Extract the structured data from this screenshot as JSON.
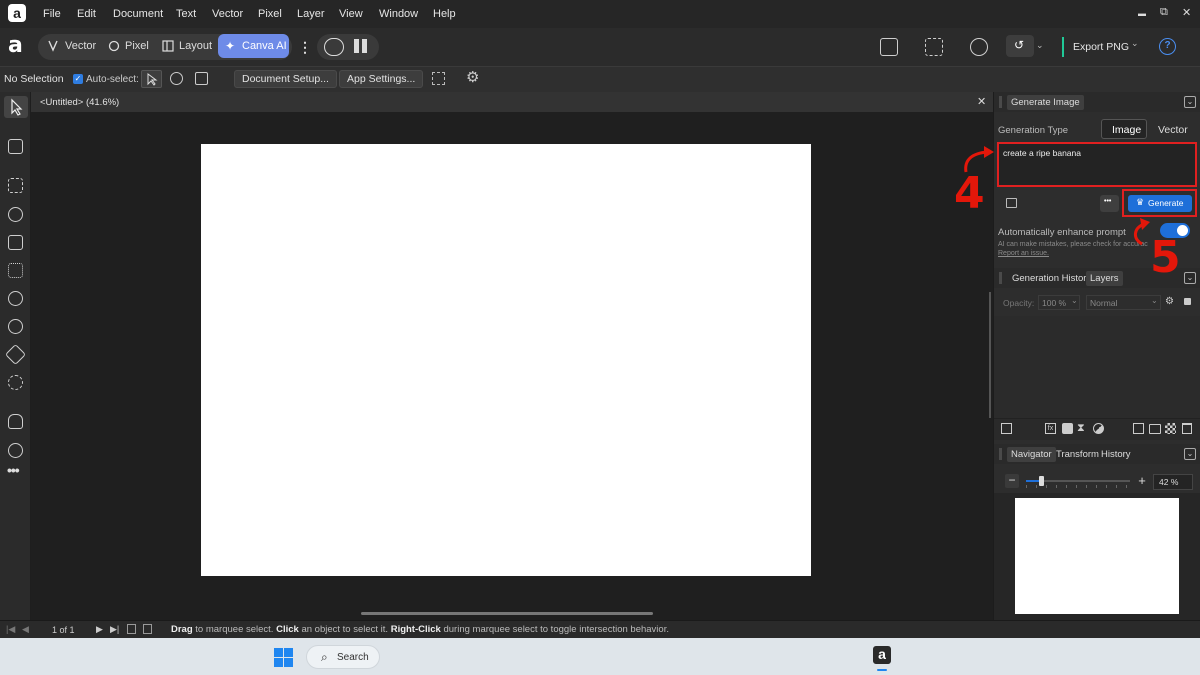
{
  "menu": [
    "File",
    "Edit",
    "Document",
    "Text",
    "Vector",
    "Pixel",
    "Layer",
    "View",
    "Window",
    "Help"
  ],
  "window_controls": {
    "minimize": "▬",
    "restore": "⧉",
    "close": "✕"
  },
  "personas": {
    "vector": "Vector",
    "pixel": "Pixel",
    "layout": "Layout",
    "canva_ai": "Canva AI"
  },
  "export": {
    "label": "Export PNG"
  },
  "context": {
    "selection": "No Selection",
    "auto_select": "Auto-select:",
    "document_setup": "Document Setup...",
    "app_settings": "App Settings..."
  },
  "document_tab": {
    "title": "<Untitled> (41.6%)"
  },
  "generate_panel": {
    "tab": "Generate Image",
    "generation_type_label": "Generation Type",
    "type_options": [
      "Image",
      "Vector"
    ],
    "prompt": "create a ripe banana",
    "more": "•••",
    "generate_label": "Generate",
    "enhance_label": "Automatically enhance prompt",
    "enhance_on": true,
    "disclaimer_1": "AI can make mistakes, please check for accurac",
    "disclaimer_2": "Report an issue."
  },
  "layers_panel": {
    "tabs": [
      "Generation History",
      "Layers"
    ],
    "opacity_label": "Opacity:",
    "opacity_value": "100 %",
    "blend_mode": "Normal"
  },
  "navigator_panel": {
    "tabs": [
      "Navigator",
      "Transform",
      "History"
    ],
    "zoom": "42 %",
    "zoom_fraction": 0.42
  },
  "annotations": {
    "step4": "4",
    "step5": "5"
  },
  "status": {
    "pages": "1 of 1",
    "hint_drag": "Drag",
    "hint_1": " to marquee select. ",
    "hint_click": "Click",
    "hint_2": " an object to select it. ",
    "hint_right": "Right-Click",
    "hint_3": " during marquee select to toggle intersection behavior."
  },
  "taskbar": {
    "search": "Search"
  },
  "colors": {
    "accent": "#1e6fd9",
    "annotation": "#e3170a"
  }
}
